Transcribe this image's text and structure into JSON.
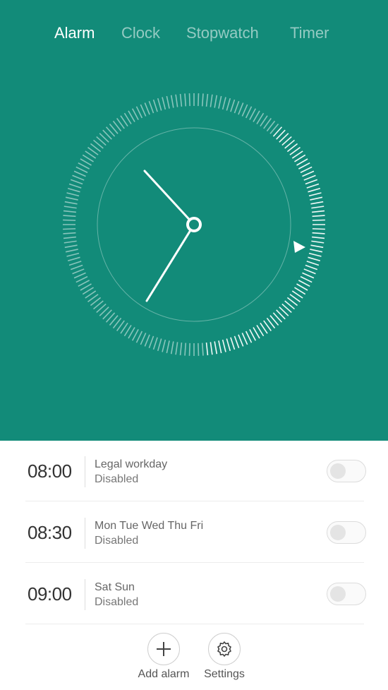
{
  "colors": {
    "accent": "#128b79",
    "inactive_tab": "#7fc4b9"
  },
  "tabs": [
    {
      "label": "Alarm",
      "active": true
    },
    {
      "label": "Clock",
      "active": false
    },
    {
      "label": "Stopwatch",
      "active": false
    },
    {
      "label": "Timer",
      "active": false
    }
  ],
  "alarms": [
    {
      "time": "08:00",
      "repeat": "Legal workday",
      "status": "Disabled",
      "enabled": false
    },
    {
      "time": "08:30",
      "repeat": "Mon Tue Wed Thu Fri",
      "status": "Disabled",
      "enabled": false
    },
    {
      "time": "09:00",
      "repeat": "Sat Sun",
      "status": "Disabled",
      "enabled": false
    }
  ],
  "actions": {
    "add_alarm_label": "Add alarm",
    "settings_label": "Settings",
    "add_icon": "plus-icon",
    "settings_icon": "gear-icon"
  }
}
